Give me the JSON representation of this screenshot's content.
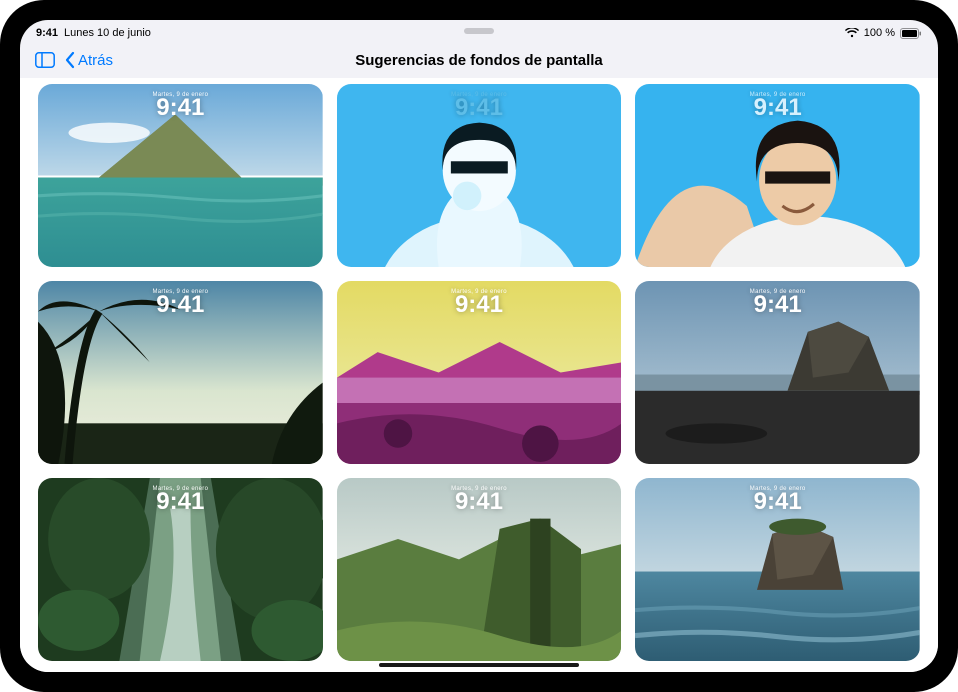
{
  "status": {
    "time": "9:41",
    "date": "Lunes 10 de junio",
    "battery_text": "100 %"
  },
  "nav": {
    "back_label": "Atrás",
    "title": "Sugerencias de fondos de pantalla"
  },
  "tile_overlay": {
    "date": "Martes, 9 de enero",
    "time": "9:41"
  },
  "tiles": [
    {
      "name": "wallpaper-volcano-sea"
    },
    {
      "name": "wallpaper-portrait-blue-1"
    },
    {
      "name": "wallpaper-portrait-blue-2"
    },
    {
      "name": "wallpaper-palm-sunset"
    },
    {
      "name": "wallpaper-beach-duotone"
    },
    {
      "name": "wallpaper-dark-rock-coast"
    },
    {
      "name": "wallpaper-river-forest"
    },
    {
      "name": "wallpaper-green-cliffs"
    },
    {
      "name": "wallpaper-sea-stack"
    }
  ]
}
